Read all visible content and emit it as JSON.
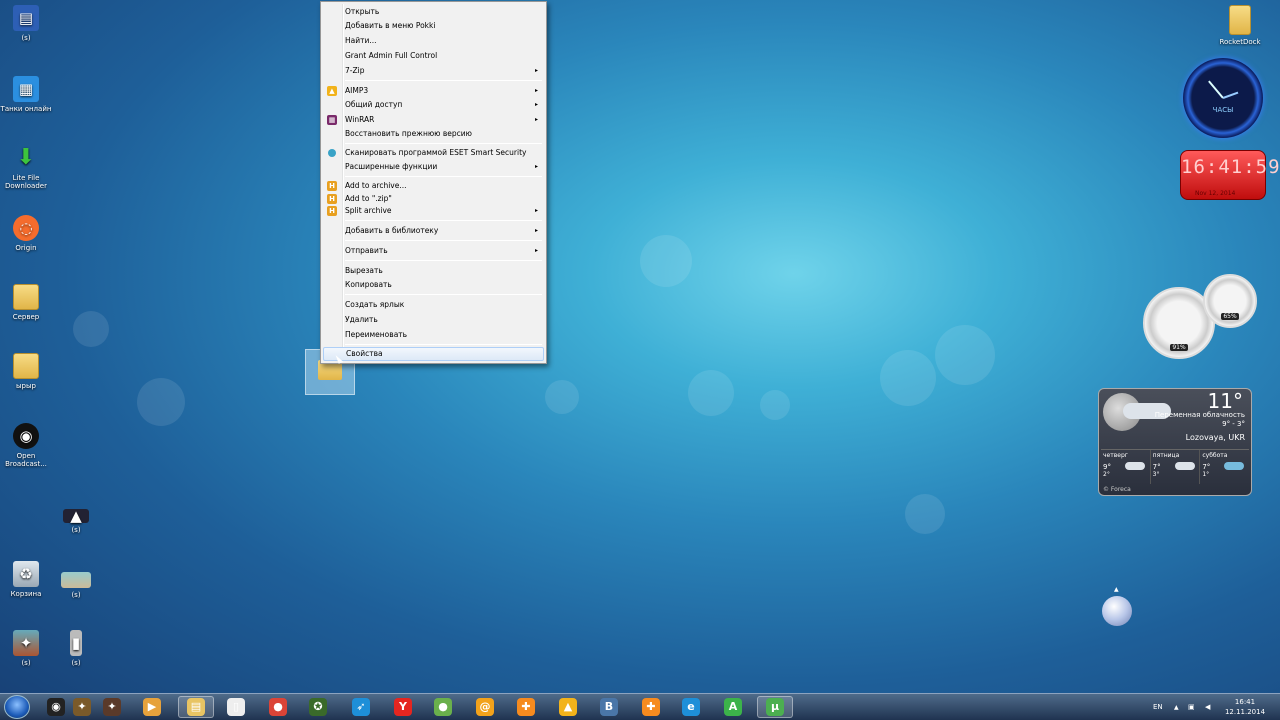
{
  "desktop": {
    "left_icons": [
      {
        "label": "(s)"
      },
      {
        "label": "Танки онлайн"
      },
      {
        "label": "Lite File Downloader"
      },
      {
        "label": "Origin"
      },
      {
        "label": "Сервер"
      },
      {
        "label": "ырыр"
      },
      {
        "label": "Open Broadcast..."
      },
      {
        "label": "(s)"
      },
      {
        "label": "Корзина"
      },
      {
        "label": "(s)"
      },
      {
        "label": "(s)"
      },
      {
        "label": "(s)"
      }
    ],
    "rocketdock_label": "RocketDock"
  },
  "context_menu": {
    "items": [
      {
        "label": "Открыть"
      },
      {
        "label": "Добавить в меню Pokki"
      },
      {
        "label": "Найти..."
      },
      {
        "label": "Grant Admin Full Control"
      },
      {
        "label": "7-Zip",
        "submenu": true
      },
      {
        "label": "AIMP3",
        "submenu": true
      },
      {
        "label": "Общий доступ",
        "submenu": true
      },
      {
        "label": "WinRAR",
        "submenu": true
      },
      {
        "label": "Восстановить прежнюю версию"
      },
      {
        "label": "Сканировать программой ESET Smart Security"
      },
      {
        "label": "Расширенные функции",
        "submenu": true
      },
      {
        "label": "Add to archive..."
      },
      {
        "label": "Add to \".zip\""
      },
      {
        "label": "Split archive",
        "submenu": true
      },
      {
        "label": "Добавить в библиотеку",
        "submenu": true
      },
      {
        "label": "Отправить",
        "submenu": true
      },
      {
        "label": "Вырезать"
      },
      {
        "label": "Копировать"
      },
      {
        "label": "Создать ярлык"
      },
      {
        "label": "Удалить"
      },
      {
        "label": "Переименовать"
      },
      {
        "label": "Свойства",
        "highlighted": true
      }
    ],
    "submenu_arrow": "▸"
  },
  "gadgets": {
    "analog_clock_label": "ЧАСЫ",
    "digital_clock": {
      "time": "16:41:59",
      "date": "Nov 12, 2014"
    },
    "cpu_meter": {
      "cpu": "91%",
      "ram": "65%"
    },
    "weather": {
      "temperature": "11°",
      "condition": "Переменная облачность",
      "range": "9° - 3°",
      "location": "Lozovaya, UKR",
      "forecast": [
        {
          "day": "четверг",
          "hi": "9°",
          "lo": "2°"
        },
        {
          "day": "пятница",
          "hi": "7°",
          "lo": "3°"
        },
        {
          "day": "суббота",
          "hi": "7°",
          "lo": "1°"
        }
      ],
      "credit": "© Foreca"
    }
  },
  "taskbar": {
    "language": "EN",
    "clock_time": "16:41",
    "clock_date": "12.11.2014",
    "apps": [
      {
        "icon": "obs-icon",
        "glyph": "◉",
        "color": "#222222"
      },
      {
        "icon": "game-icon",
        "glyph": "✦",
        "color": "#7a5a2a"
      },
      {
        "icon": "game2-icon",
        "glyph": "✦",
        "color": "#5a3a2a"
      },
      {
        "icon": "media-player-icon",
        "glyph": "▶",
        "color": "#e6a23c"
      },
      {
        "icon": "explorer-icon",
        "glyph": "▤",
        "color": "#e8c463"
      },
      {
        "icon": "document-icon",
        "glyph": "▯",
        "color": "#eeeeee"
      },
      {
        "icon": "chrome-icon",
        "glyph": "●",
        "color": "#db4437"
      },
      {
        "icon": "world-of-tanks-icon",
        "glyph": "✪",
        "color": "#3a6a2a"
      },
      {
        "icon": "bird-icon",
        "glyph": "➶",
        "color": "#1e8fd8"
      },
      {
        "icon": "yandex-browser-icon",
        "glyph": "Y",
        "color": "#e52620"
      },
      {
        "icon": "ball-icon",
        "glyph": "●",
        "color": "#6ab04c"
      },
      {
        "icon": "mail-agent-icon",
        "glyph": "@",
        "color": "#f2a21b"
      },
      {
        "icon": "odnoklassniki-icon",
        "glyph": "✚",
        "color": "#f68b1f"
      },
      {
        "icon": "aimp-icon",
        "glyph": "▲",
        "color": "#f2b31b"
      },
      {
        "icon": "vkontakte-icon",
        "glyph": "B",
        "color": "#4a76a8"
      },
      {
        "icon": "odnoklassniki2-icon",
        "glyph": "✚",
        "color": "#f68b1f"
      },
      {
        "icon": "internet-explorer-icon",
        "glyph": "e",
        "color": "#1e8fd8"
      },
      {
        "icon": "a-icon",
        "glyph": "A",
        "color": "#3cb34a"
      },
      {
        "icon": "utorrent-icon",
        "glyph": "µ",
        "color": "#4caf50"
      }
    ]
  }
}
